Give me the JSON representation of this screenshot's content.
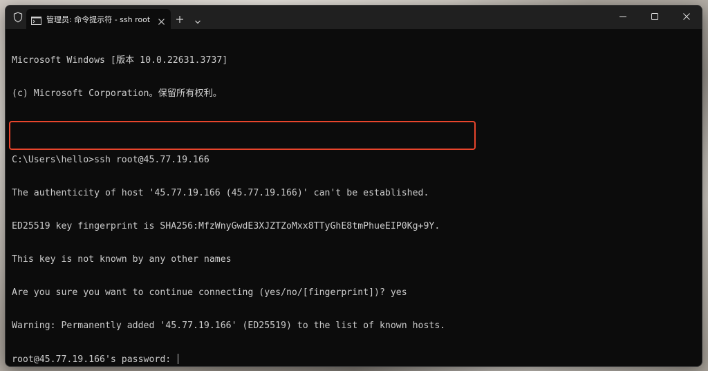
{
  "window": {
    "tab_title": "管理员: 命令提示符 - ssh  root"
  },
  "terminal": {
    "lines": [
      "Microsoft Windows [版本 10.0.22631.3737]",
      "(c) Microsoft Corporation。保留所有权利。",
      "",
      "C:\\Users\\hello>ssh root@45.77.19.166",
      "The authenticity of host '45.77.19.166 (45.77.19.166)' can't be established.",
      "ED25519 key fingerprint is SHA256:MfzWnyGwdE3XJZTZoMxx8TTyGhE8tmPhueEIP0Kg+9Y.",
      "This key is not known by any other names",
      "Are you sure you want to continue connecting (yes/no/[fingerprint])? yes",
      "Warning: Permanently added '45.77.19.166' (ED25519) to the list of known hosts.",
      "root@45.77.19.166's password: "
    ]
  },
  "colors": {
    "terminal_background": "#0c0c0c",
    "terminal_text": "#cccccc",
    "titlebar_background": "#202020",
    "highlight_border": "#e8452c"
  },
  "icons": {
    "shield": "shield-icon",
    "tab": "terminal-icon",
    "tab_close": "close-icon",
    "new_tab": "plus-icon",
    "dropdown": "chevron-down-icon",
    "minimize": "minimize-icon",
    "maximize": "maximize-icon",
    "close": "close-icon"
  }
}
